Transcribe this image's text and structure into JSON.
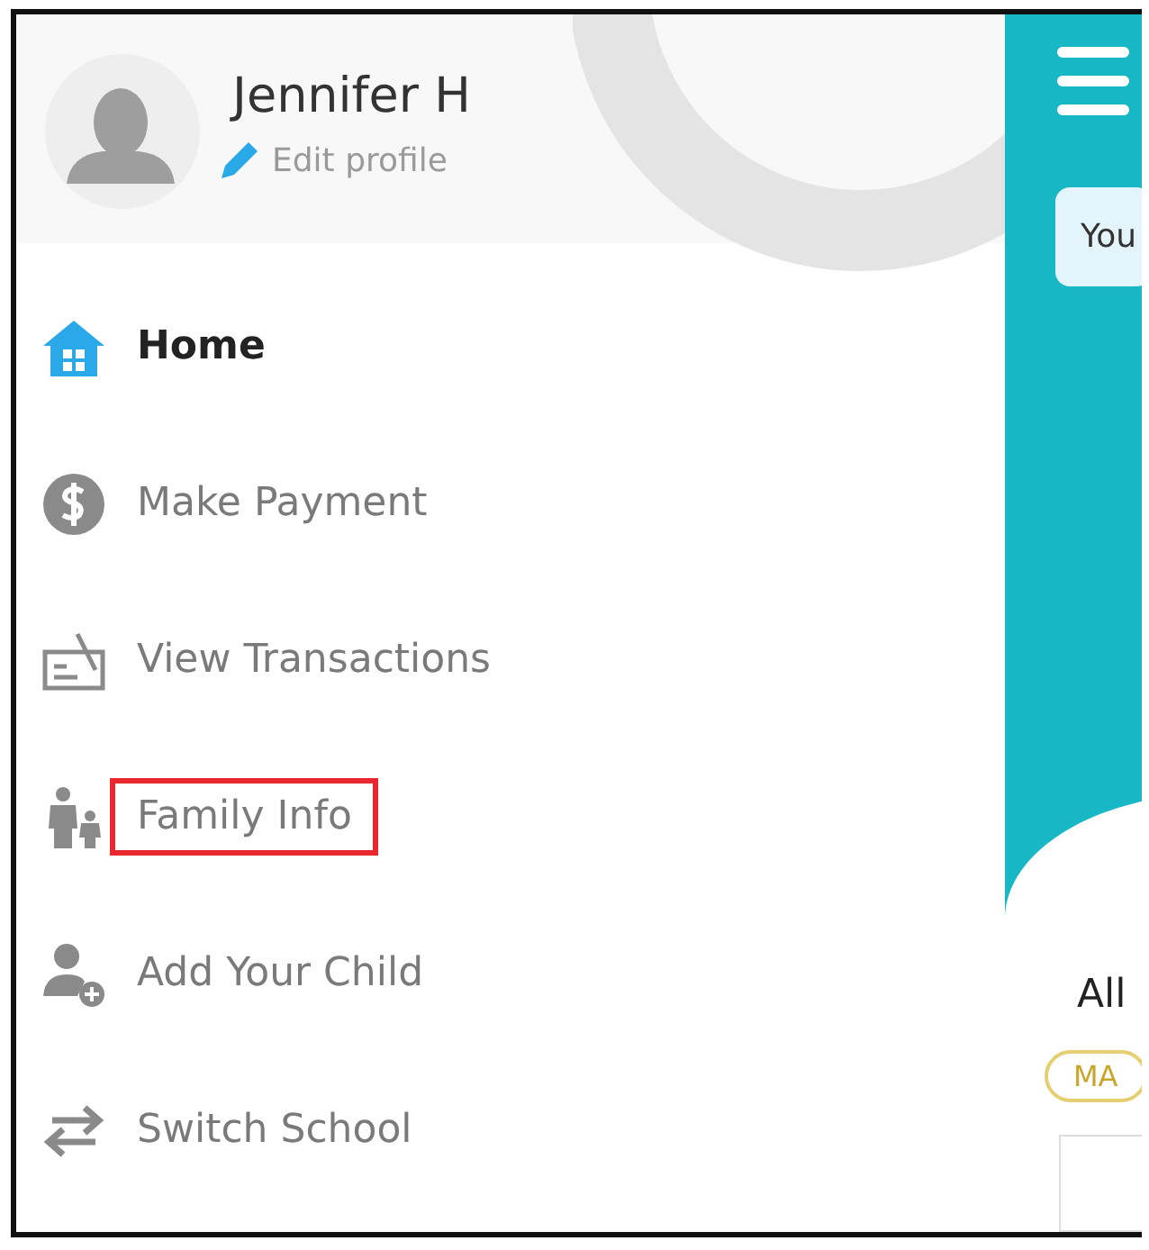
{
  "profile": {
    "name": "Jennifer H",
    "edit_label": "Edit profile"
  },
  "menu": [
    {
      "label": "Home",
      "kind": "home",
      "selected": true,
      "highlighted": false
    },
    {
      "label": "Make Payment",
      "kind": "payment",
      "selected": false,
      "highlighted": false
    },
    {
      "label": "View Transactions",
      "kind": "transactions",
      "selected": false,
      "highlighted": false
    },
    {
      "label": "Family Info",
      "kind": "family",
      "selected": false,
      "highlighted": true
    },
    {
      "label": "Add Your Child",
      "kind": "add-child",
      "selected": false,
      "highlighted": false
    },
    {
      "label": "Switch School",
      "kind": "switch",
      "selected": false,
      "highlighted": false
    }
  ],
  "main": {
    "notice": "You",
    "section_title": "All",
    "tag": "MA"
  }
}
